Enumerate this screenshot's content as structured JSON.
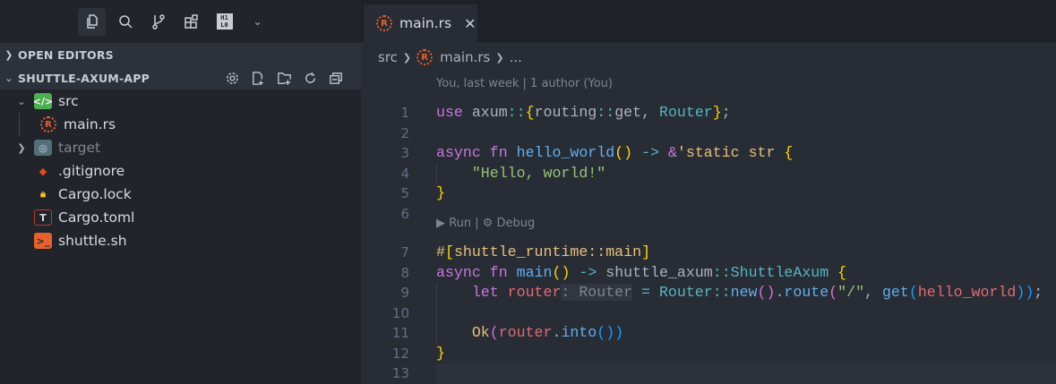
{
  "activity_bar": {
    "items": [
      "explorer-icon",
      "search-icon",
      "source-control-icon",
      "extensions-icon",
      "hex-editor-icon",
      "chevron-down-icon"
    ]
  },
  "sidebar": {
    "open_editors": "OPEN EDITORS",
    "project": "SHUTTLE-AXUM-APP",
    "tree": [
      {
        "label": "src",
        "icon": "folder-src-icon",
        "depth": 1,
        "expanded": true,
        "color": "#d7dae0"
      },
      {
        "label": "main.rs",
        "icon": "rust-icon",
        "depth": 2,
        "color": "#d7dae0"
      },
      {
        "label": "target",
        "icon": "folder-target-icon",
        "depth": 1,
        "expanded": false,
        "color": "#7f848e"
      },
      {
        "label": ".gitignore",
        "icon": "git-icon",
        "depth": 1,
        "color": "#d7dae0"
      },
      {
        "label": "Cargo.lock",
        "icon": "lock-icon",
        "depth": 1,
        "color": "#d7dae0"
      },
      {
        "label": "Cargo.toml",
        "icon": "toml-icon",
        "depth": 1,
        "color": "#d7dae0"
      },
      {
        "label": "shuttle.sh",
        "icon": "terminal-icon",
        "depth": 1,
        "color": "#d7dae0"
      }
    ]
  },
  "tab": {
    "label": "main.rs",
    "close": "✕"
  },
  "breadcrumb": {
    "folder": "src",
    "file": "main.rs",
    "more": "..."
  },
  "editor": {
    "blame": "You, last week | 1 author (You)",
    "codelens": {
      "run": "Run",
      "sep": "|",
      "debug": "Debug"
    },
    "lines": [
      {
        "n": "1",
        "tokens": [
          [
            "use",
            "k"
          ],
          [
            " axum",
            "p"
          ],
          [
            "::",
            "o"
          ],
          [
            "{",
            "b"
          ],
          [
            "routing",
            "p"
          ],
          [
            "::",
            "o"
          ],
          [
            "get, ",
            "p"
          ],
          [
            "Router",
            "t"
          ],
          [
            "}",
            "b"
          ],
          [
            ";",
            "p"
          ]
        ]
      },
      {
        "n": "2",
        "tokens": []
      },
      {
        "n": "3",
        "tokens": [
          [
            "async",
            "k"
          ],
          [
            " fn ",
            "k"
          ],
          [
            "hello_world",
            "f"
          ],
          [
            "()",
            "b"
          ],
          [
            " -> ",
            "o"
          ],
          [
            "&",
            "k"
          ],
          [
            "'static str ",
            "y"
          ],
          [
            "{",
            "b"
          ]
        ]
      },
      {
        "n": "4",
        "tokens": [
          [
            "    ",
            "p"
          ],
          [
            "\"Hello, world!\"",
            "s"
          ]
        ]
      },
      {
        "n": "5",
        "tokens": [
          [
            "}",
            "b"
          ]
        ]
      },
      {
        "n": "6",
        "tokens": []
      },
      {
        "n": "7",
        "tokens": [
          [
            "#",
            "y"
          ],
          [
            "[",
            "b"
          ],
          [
            "shuttle_runtime::main",
            "y"
          ],
          [
            "]",
            "b"
          ]
        ]
      },
      {
        "n": "8",
        "tokens": [
          [
            "async",
            "k"
          ],
          [
            " fn ",
            "k"
          ],
          [
            "main",
            "f"
          ],
          [
            "()",
            "b"
          ],
          [
            " -> ",
            "o"
          ],
          [
            "shuttle_axum",
            "p"
          ],
          [
            "::",
            "o"
          ],
          [
            "ShuttleAxum",
            "t"
          ],
          [
            " {",
            "b"
          ]
        ]
      },
      {
        "n": "9",
        "tokens": [
          [
            "    let ",
            "k"
          ],
          [
            "router",
            "v"
          ],
          [
            ": Router",
            "hint"
          ],
          [
            " = ",
            "o"
          ],
          [
            "Router",
            "t"
          ],
          [
            "::",
            "o"
          ],
          [
            "new",
            "f"
          ],
          [
            "()",
            "pk"
          ],
          [
            ".",
            "p"
          ],
          [
            "route",
            "f"
          ],
          [
            "(",
            "pk"
          ],
          [
            "\"/\"",
            "s"
          ],
          [
            ", ",
            "p"
          ],
          [
            "get",
            "f"
          ],
          [
            "(",
            "bb"
          ],
          [
            "hello_world",
            "v"
          ],
          [
            "))",
            "bb"
          ],
          [
            ";",
            "p"
          ]
        ]
      },
      {
        "n": "10",
        "tokens": []
      },
      {
        "n": "11",
        "tokens": [
          [
            "    Ok",
            "y"
          ],
          [
            "(",
            "pk"
          ],
          [
            "router",
            "v"
          ],
          [
            ".",
            "p"
          ],
          [
            "into",
            "f"
          ],
          [
            "())",
            "bb"
          ]
        ]
      },
      {
        "n": "12",
        "tokens": [
          [
            "}",
            "b"
          ]
        ]
      },
      {
        "n": "13",
        "tokens": []
      }
    ]
  }
}
